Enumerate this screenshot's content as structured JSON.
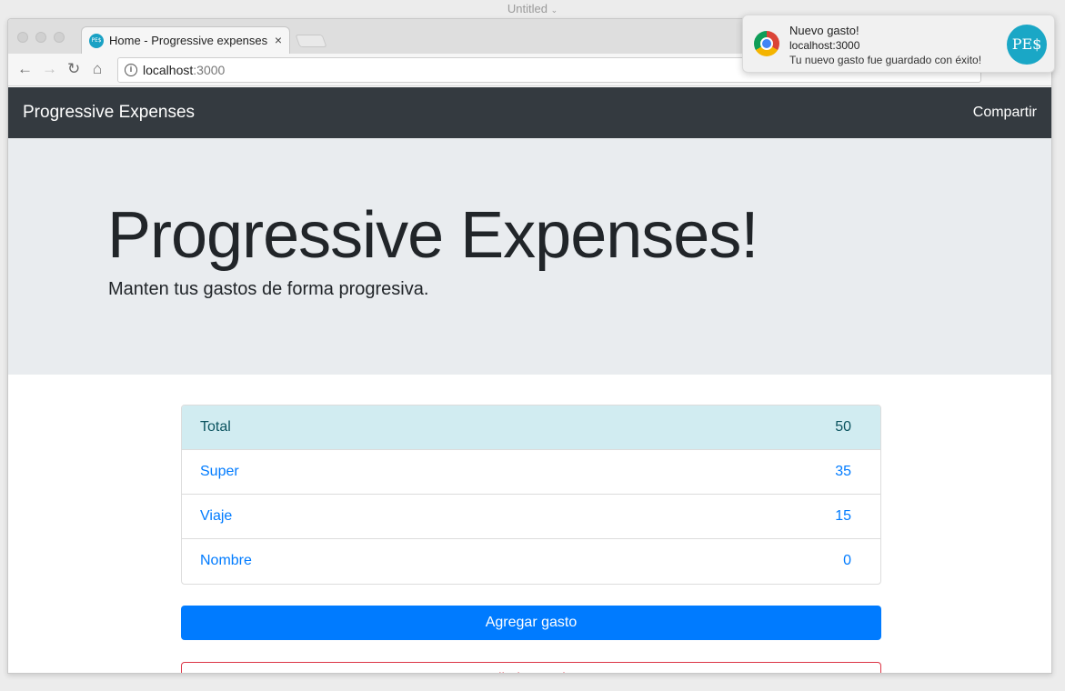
{
  "os": {
    "window_title": "Untitled"
  },
  "browser": {
    "tab": {
      "title": "Home - Progressive expenses",
      "favicon_text": "PE$"
    },
    "address": {
      "host": "localhost",
      "port": ":3000"
    }
  },
  "navbar": {
    "brand": "Progressive Expenses",
    "share_label": "Compartir"
  },
  "hero": {
    "title": "Progressive Expenses!",
    "subtitle": "Manten tus gastos de forma progresiva."
  },
  "expenses": {
    "total": {
      "label": "Total",
      "value": "50"
    },
    "items": [
      {
        "label": "Super",
        "value": "35"
      },
      {
        "label": "Viaje",
        "value": "15"
      },
      {
        "label": "Nombre",
        "value": "0"
      }
    ]
  },
  "actions": {
    "add_label": "Agregar gasto",
    "delete_label": "Eliminar todo"
  },
  "notification": {
    "title": "Nuevo gasto!",
    "origin": "localhost:3000",
    "body": "Tu nuevo gasto fue guardado con éxito!",
    "image_text": "PE$"
  },
  "colors": {
    "navbar": "#343a40",
    "jumbotron": "#e9ecef",
    "primary": "#007bff",
    "info_bg": "#d1ecf1",
    "danger": "#dc3545"
  }
}
